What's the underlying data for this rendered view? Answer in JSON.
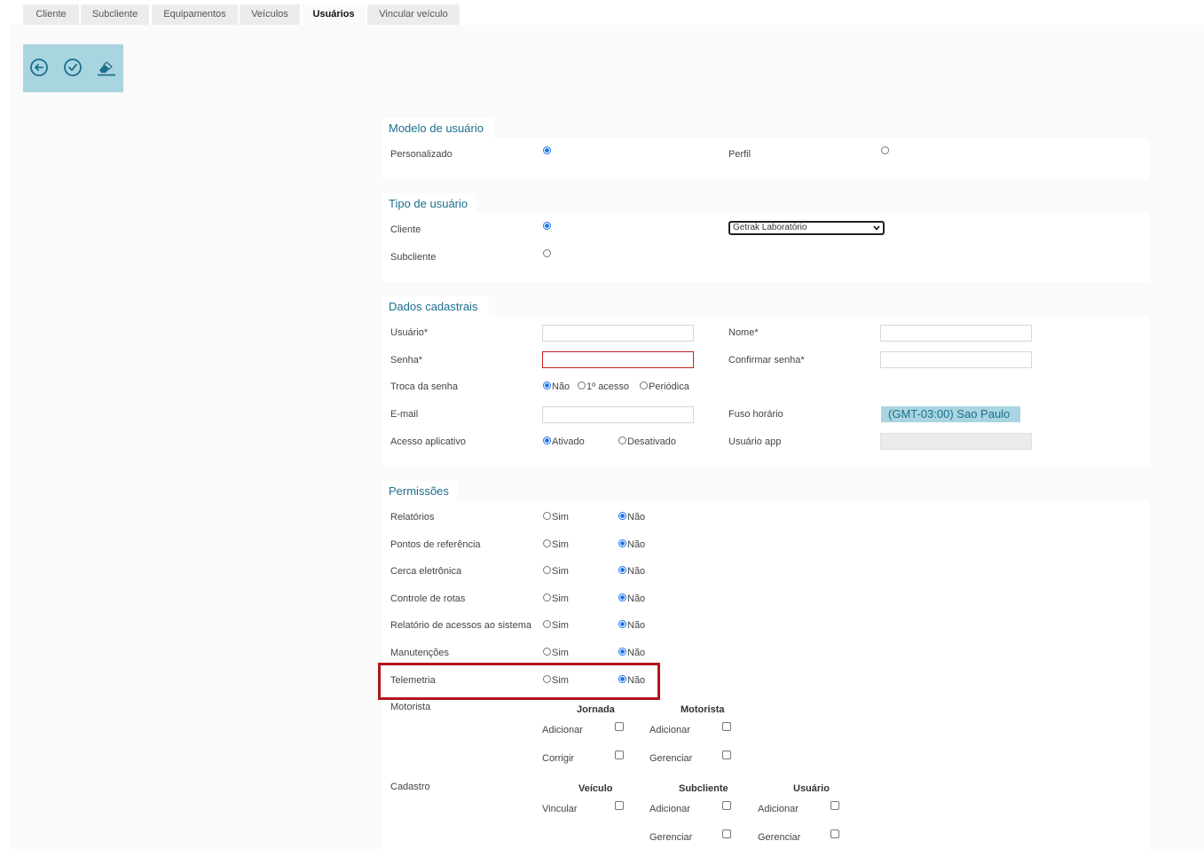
{
  "tabs": [
    "Cliente",
    "Subcliente",
    "Equipamentos",
    "Veículos",
    "Usuários",
    "Vincular veículo"
  ],
  "active_tab": "Usuários",
  "toolbar": {
    "icons": [
      "back-circle-icon",
      "check-circle-icon",
      "eraser-icon"
    ]
  },
  "colors": {
    "accent": "#1b6f8c",
    "toolbar_bg": "#a9d5e0",
    "radio_selected": "#1a73e8",
    "error_border": "#c21f1f",
    "highlight": "#b3141a"
  },
  "modelo": {
    "title": "Modelo de usuário",
    "personalizado": "Personalizado",
    "perfil": "Perfil",
    "selected": "Personalizado"
  },
  "tipo": {
    "title": "Tipo de usuário",
    "cliente": "Cliente",
    "subcliente": "Subcliente",
    "selected": "Cliente",
    "cliente_select": "Getrak Laboratório"
  },
  "dados": {
    "title": "Dados cadastrais",
    "usuario": "Usuário*",
    "nome": "Nome*",
    "senha": "Senha*",
    "confirmar": "Confirmar senha*",
    "troca": "Troca da senha",
    "troca_opts": [
      "Não",
      "1º acesso",
      "Periódica"
    ],
    "troca_selected": "Não",
    "email": "E-mail",
    "fuso": "Fuso horário",
    "fuso_value": "(GMT-03:00) Sao Paulo",
    "acesso": "Acesso aplicativo",
    "acesso_opts": [
      "Ativado",
      "Desativado"
    ],
    "acesso_selected": "Ativado",
    "usuario_app": "Usuário app"
  },
  "perm": {
    "title": "Permissões",
    "sim": "Sim",
    "nao": "Não",
    "rows": [
      "Relatórios",
      "Pontos de referência",
      "Cerca eletrônica",
      "Controle de rotas",
      "Relatório de acessos ao sistema",
      "Manutenções",
      "Telemetria"
    ],
    "selected_all": "Não",
    "motorista": "Motorista",
    "jornada": "Jornada",
    "motorista_col": "Motorista",
    "adicionar": "Adicionar",
    "corrigir": "Corrigir",
    "gerenciar": "Gerenciar",
    "cadastro": "Cadastro",
    "veiculo": "Veículo",
    "subcliente": "Subcliente",
    "usuario": "Usuário",
    "vincular": "Vincular"
  }
}
